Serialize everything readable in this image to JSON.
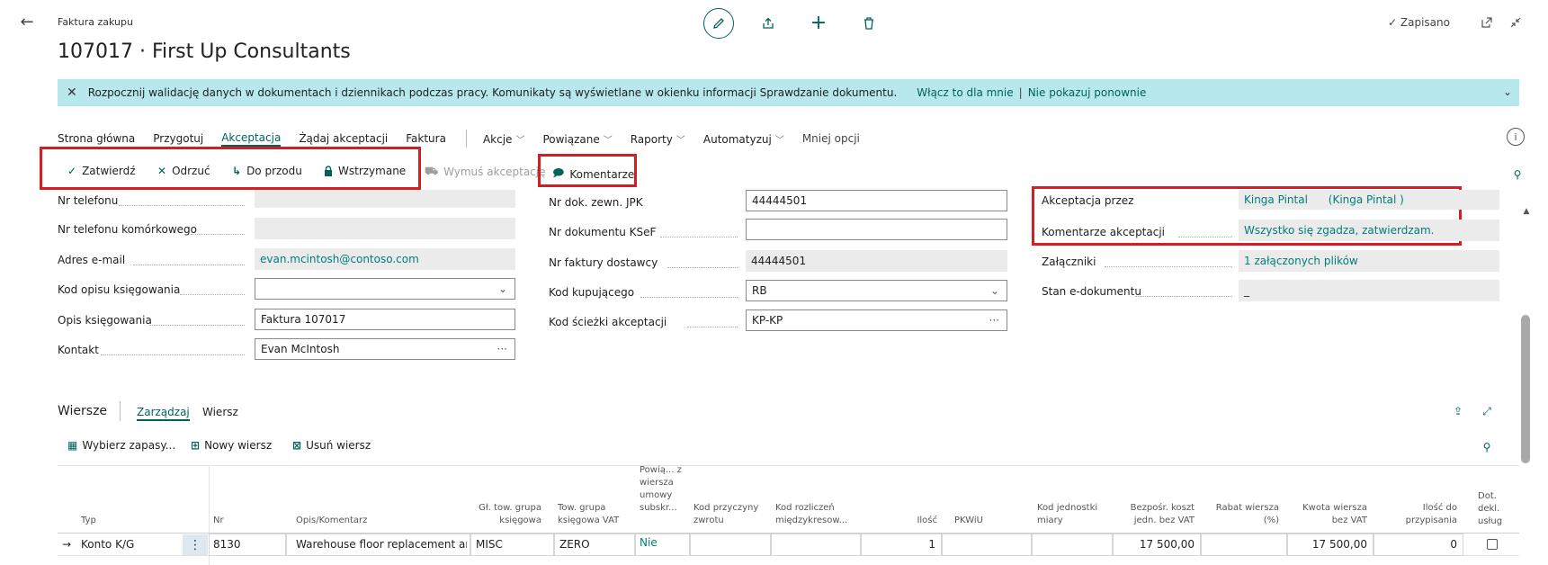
{
  "header": {
    "page_type": "Faktura zakupu",
    "record_title": "107017 · First Up Consultants",
    "saved_label": "Zapisano",
    "saved_check": "✓"
  },
  "banner": {
    "message": "Rozpocznij walidację danych w dokumentach i dziennikach podczas pracy. Komunikaty są wyświetlane w okienku informacji Sprawdzanie dokumentu.",
    "enable_action": "Włącz to dla mnie",
    "separator": "|",
    "dismiss_action": "Nie pokazuj ponownie"
  },
  "action_tabs": {
    "items": [
      {
        "label": "Strona główna",
        "active": false
      },
      {
        "label": "Przygotuj",
        "active": false
      },
      {
        "label": "Akceptacja",
        "active": true
      },
      {
        "label": "Żądaj akceptacji",
        "active": false
      },
      {
        "label": "Faktura",
        "active": false
      }
    ],
    "menus": [
      "Akcje",
      "Powiązane",
      "Raporty",
      "Automatyzuj"
    ],
    "less_options": "Mniej opcji"
  },
  "command_bar": {
    "approve": "Zatwierdź",
    "reject": "Odrzuć",
    "delegate": "Do przodu",
    "hold": "Wstrzymane",
    "force_approval": "Wymuś akceptację",
    "comments": "Komentarze"
  },
  "fields_col1": {
    "phone": {
      "label": "Nr telefonu",
      "value": ""
    },
    "mobile": {
      "label": "Nr telefonu komórkowego",
      "value": ""
    },
    "email": {
      "label": "Adres e-mail",
      "value": "evan.mcintosh@contoso.com"
    },
    "posting_desc_code": {
      "label": "Kod opisu księgowania",
      "value": ""
    },
    "posting_desc": {
      "label": "Opis księgowania",
      "value": "Faktura 107017"
    },
    "contact": {
      "label": "Kontakt",
      "value": "Evan McIntosh"
    }
  },
  "fields_col2": {
    "ext_doc_jpk": {
      "label": "Nr dok. zewn. JPK",
      "value": "44444501"
    },
    "ksef_doc": {
      "label": "Nr dokumentu KSeF",
      "value": ""
    },
    "vendor_invoice": {
      "label": "Nr faktury dostawcy",
      "value": "44444501"
    },
    "purchaser_code": {
      "label": "Kod kupującego",
      "value": "RB"
    },
    "approval_path": {
      "label": "Kod ścieżki akceptacji",
      "value": "KP-KP"
    }
  },
  "fields_col3": {
    "approved_by": {
      "label": "Akceptacja przez",
      "value": "Kinga Pintal      (Kinga Pintal )"
    },
    "approval_comments": {
      "label": "Komentarze akceptacji",
      "value": "Wszystko się zgadza, zatwierdzam."
    },
    "attachments": {
      "label": "Załączniki",
      "value": "1 załączonych plików"
    },
    "edoc_status": {
      "label": "Stan e-dokumentu",
      "value": "_"
    }
  },
  "lines": {
    "title": "Wiersze",
    "tab_manage": "Zarządzaj",
    "tab_line": "Wiersz",
    "select_items": "Wybierz zapasy...",
    "new_line": "Nowy wiersz",
    "delete_line": "Usuń wiersz",
    "columns": {
      "type": "Typ",
      "no": "Nr",
      "description": "Opis/Komentarz",
      "gen_prod_group": "Gł. tow. grupa księgowa",
      "vat_prod_group": "Tow. grupa księgowa VAT",
      "linked_sub": "Powią... z wiersza umowy subskr...",
      "return_reason": "Kod przyczyny zwrotu",
      "ic_code": "Kod rozliczeń międzykresow...",
      "quantity": "Ilość",
      "pkwiu": "PKWiU",
      "uom": "Kod jednostki miary",
      "unit_cost": "Bezpośr. koszt jedn. bez VAT",
      "discount": "Rabat wiersza (%)",
      "amount": "Kwota wiersza bez VAT",
      "qty_assign": "Ilość do przypisania",
      "extra": "Dot. dekl. usług"
    },
    "rows": [
      {
        "type": "Konto K/G",
        "no": "8130",
        "description": "Warehouse floor replacement an...",
        "gen_prod_group": "MISC",
        "vat_prod_group": "ZERO",
        "linked_sub": "Nie",
        "quantity": "1",
        "unit_cost": "17 500,00",
        "amount": "17 500,00",
        "qty_assign": "0"
      }
    ]
  },
  "colors": {
    "accent": "#00635a",
    "banner_bg": "#b7e8ee",
    "highlight_box": "#d21f26"
  }
}
